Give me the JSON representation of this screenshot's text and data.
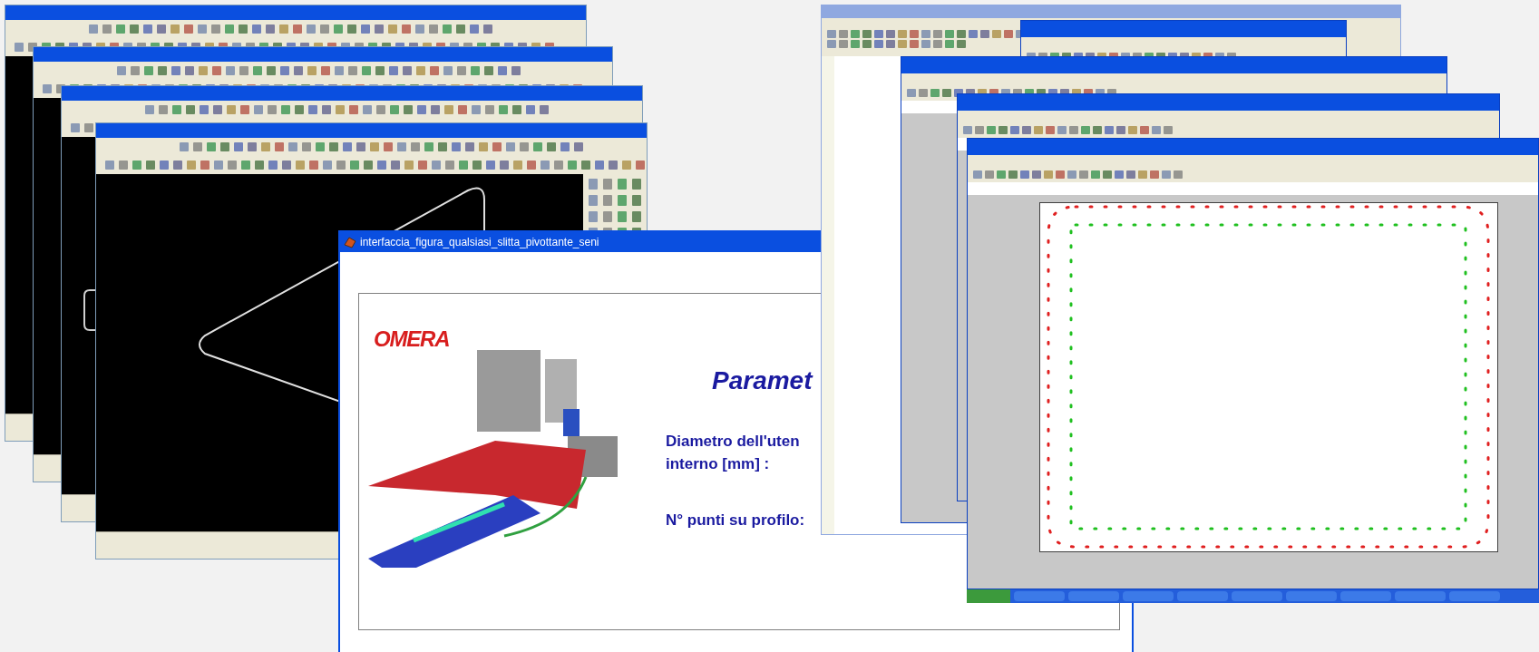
{
  "dialog": {
    "title": "interfaccia_figura_qualsiasi_slitta_pivottante_seni",
    "logo": "OMERA",
    "heading": "Paramet",
    "labels": [
      {
        "lines": [
          "Diametro dell'uten",
          "interno [mm] :"
        ]
      },
      {
        "lines": [
          "N° punti su profilo:"
        ]
      }
    ]
  }
}
